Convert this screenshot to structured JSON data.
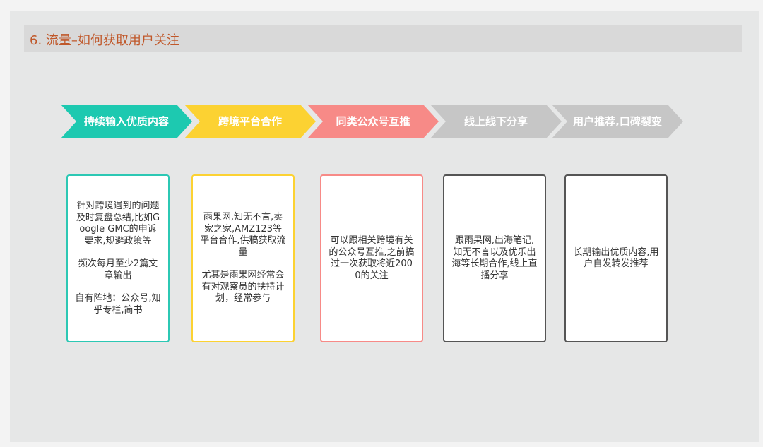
{
  "title": "6. 流量–如何获取用户关注",
  "colors": {
    "teal": "#1dc9b0",
    "yellow": "#fcd232",
    "pink": "#f78a87",
    "gray": "#c6c6c6",
    "title": "#c0582a"
  },
  "steps": [
    {
      "label": "持续输入优质内容",
      "color": "#1dc9b0"
    },
    {
      "label": "跨境平台合作",
      "color": "#fcd232"
    },
    {
      "label": "同类公众号互推",
      "color": "#f78a87"
    },
    {
      "label": "线上线下分享",
      "color": "#c6c6c6"
    },
    {
      "label": "用户推荐,口碑裂变",
      "color": "#c6c6c6"
    }
  ],
  "cards": [
    {
      "border": "#2cc8b4",
      "paragraphs": [
        "针对跨境遇到的问题及时复盘总结,比如Google GMC的申诉要求,规避政策等",
        "频次每月至少2篇文章输出",
        "自有阵地：公众号,知乎专栏,简书"
      ]
    },
    {
      "border": "#fcd232",
      "paragraphs": [
        "雨果网,知无不言,卖家之家,AMZ123等平台合作,供稿获取流量",
        "尤其是雨果网经常会有对观察员的扶持计划，经常参与"
      ]
    },
    {
      "border": "#f78a87",
      "paragraphs": [
        "可以跟相关跨境有关的公众号互推,之前搞过一次获取将近2000的关注"
      ]
    },
    {
      "border": "#555555",
      "paragraphs": [
        "跟雨果网,出海笔记,知无不言以及优乐出海等长期合作,线上直播分享"
      ]
    },
    {
      "border": "#555555",
      "paragraphs": [
        "长期输出优质内容,用户自发转发推荐"
      ]
    }
  ]
}
